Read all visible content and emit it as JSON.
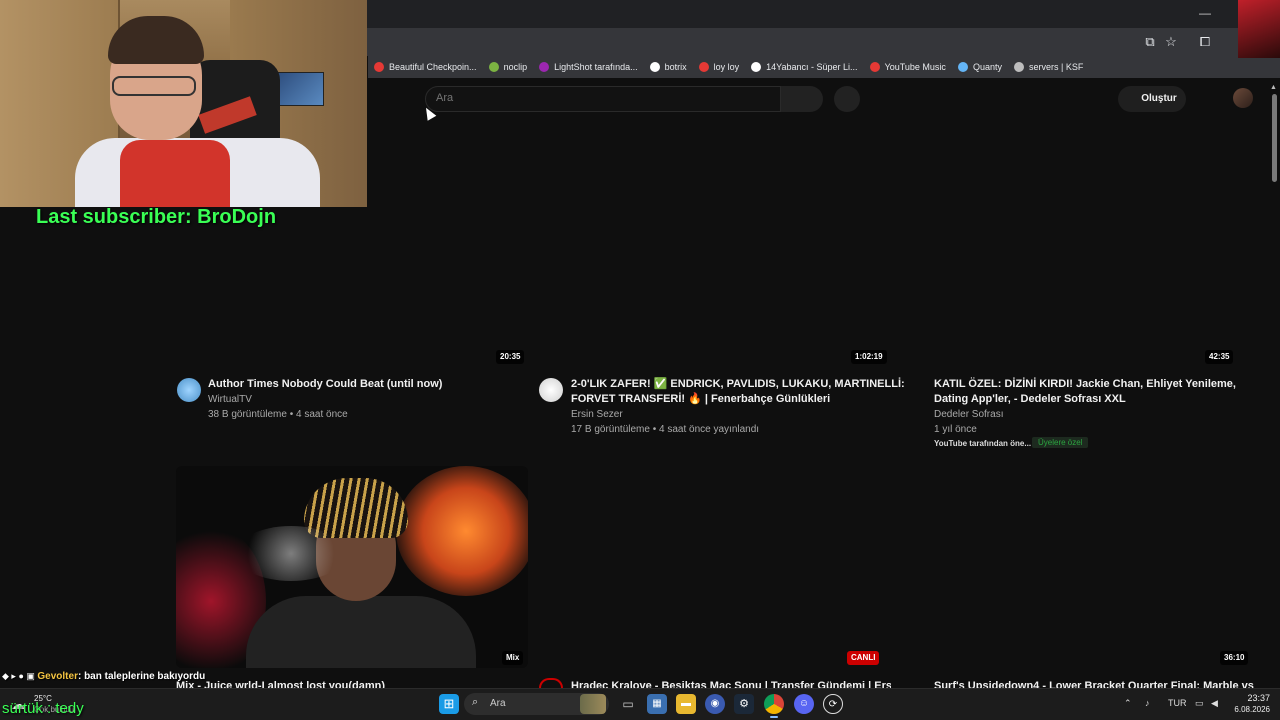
{
  "browser": {
    "bookmarks": [
      {
        "label": "Beautiful Checkpoin...",
        "color": "#e53935"
      },
      {
        "label": "noclip",
        "color": "#7cb342"
      },
      {
        "label": "LightShot tarafında...",
        "color": "#9c27b0"
      },
      {
        "label": "botrix",
        "color": "#ffffff"
      },
      {
        "label": "loy loy",
        "color": "#e53935"
      },
      {
        "label": "14Yabancı - Süper Li...",
        "color": "#ffffff"
      },
      {
        "label": "YouTube Music",
        "color": "#e53935"
      },
      {
        "label": "Quanty",
        "color": "#64b5f6"
      },
      {
        "label": "servers | KSF",
        "color": "#bdbdbd"
      }
    ]
  },
  "youtube": {
    "search_placeholder": "Ara",
    "create_label": "Oluştur"
  },
  "overlay": {
    "last_subscriber": "Last subscriber: BroDojn",
    "chat_user": "Gevolter",
    "chat_message": ": ban taleplerine bakıyordu",
    "bottom_text": "sürtük : tedy"
  },
  "videos": [
    {
      "duration": "20:35",
      "title": "Author Times Nobody Could Beat (until now)",
      "channel": "WirtualTV",
      "stats": "38 B görüntüleme • 4 saat önce"
    },
    {
      "duration": "1:02:19",
      "title_line1": "2-0'LIK ZAFER! ✅ ENDRICK, PAVLIDIS, LUKAKU, MARTINELLİ:",
      "title_line2": "FORVET TRANSFERİ! 🔥 | Fenerbahçe Günlükleri",
      "channel": "Ersin Sezer",
      "stats": "17 B görüntüleme • 4 saat önce yayınlandı"
    },
    {
      "duration": "42:35",
      "title_line1": "KATIL ÖZEL: DİZİNİ KIRDI! Jackie Chan, Ehliyet Yenileme,",
      "title_line2": "Dating App'ler, - Dedeler Sofrası XXL",
      "channel": "Dedeler Sofrası",
      "stats": "1 yıl önce",
      "tag": "YouTube tarafından öne...",
      "members_badge": "Üyelere özel"
    },
    {
      "duration": "Mix",
      "title": "Mix - Juice wrld-I almost lost you(damn)"
    },
    {
      "duration": "CANLI",
      "title": "Hradec Kralove - Besiktas Maç Sonu | Transfer Gündemi | Ersin"
    },
    {
      "duration": "36:10",
      "title": "Surf's Upsidedown4 - Lower Bracket Quarter Final: Marble vs"
    }
  ],
  "taskbar": {
    "weather_temp": "25°C",
    "weather_sub": "Çok bulutlu",
    "search_label": "Ara",
    "lang": "TUR",
    "time": "23:37",
    "date": "6.08.2026"
  }
}
